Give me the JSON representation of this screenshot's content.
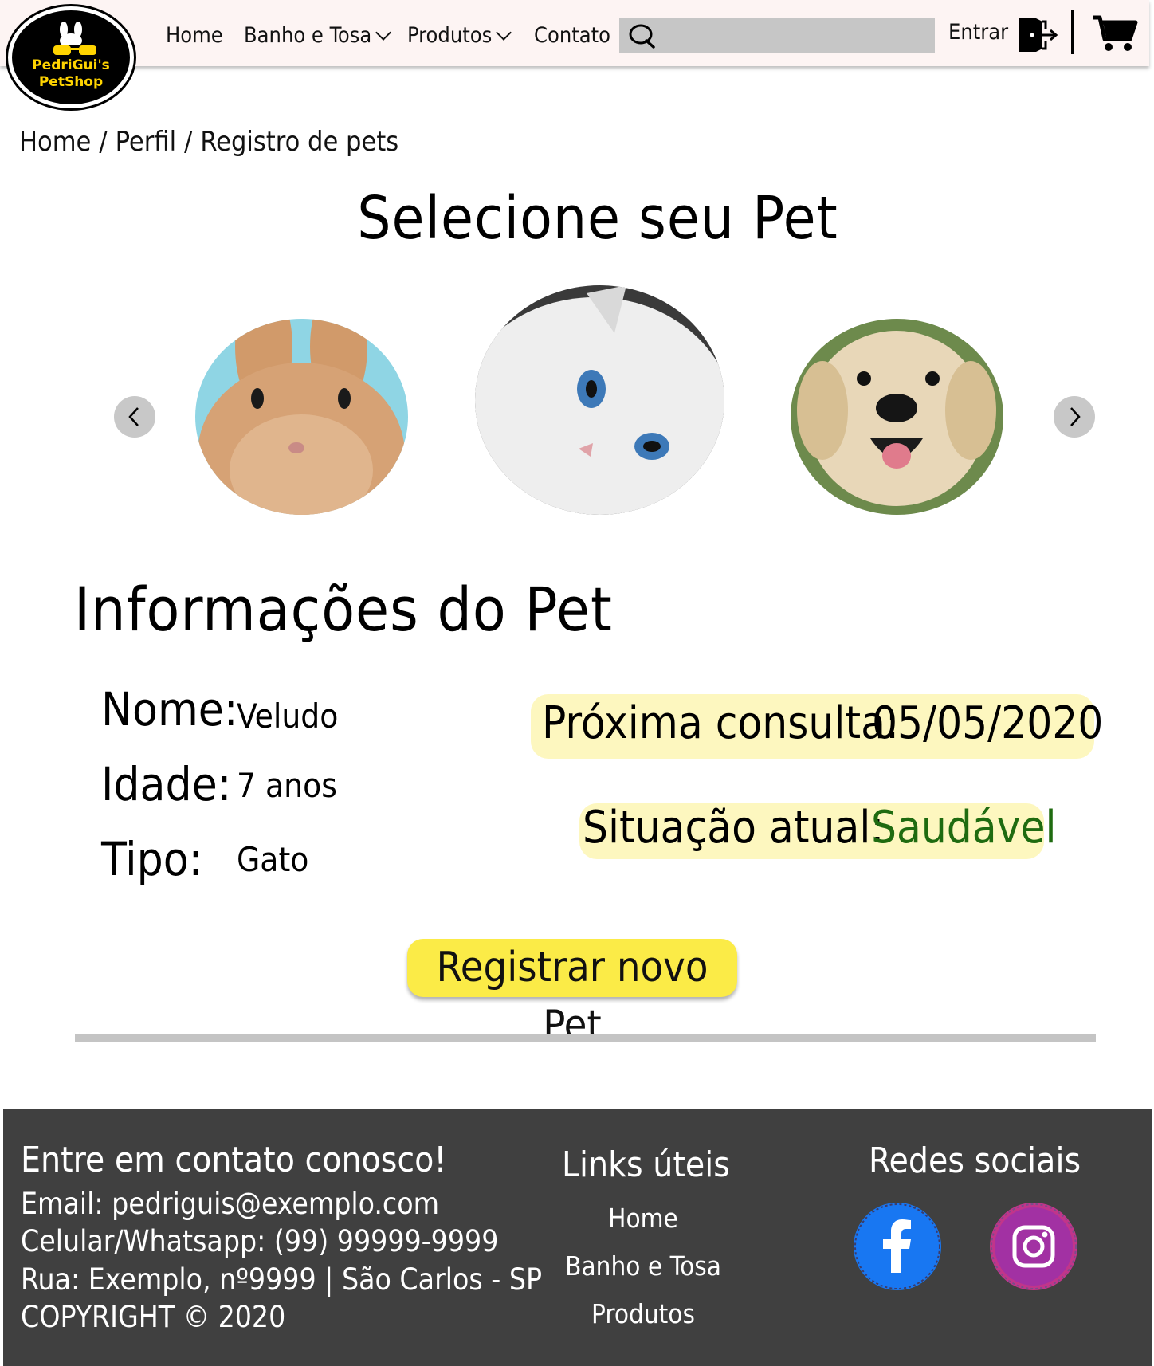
{
  "brand": {
    "logo_line1": "PedriGui's",
    "logo_line2": "PetShop"
  },
  "nav": {
    "home": "Home",
    "banho": "Banho e Tosa",
    "produtos": "Produtos",
    "contato": "Contato",
    "search_placeholder": "",
    "entrar": "Entrar"
  },
  "breadcrumb": {
    "items": [
      "Home",
      "Perfil",
      "Registro de pets"
    ],
    "sep": "/"
  },
  "page": {
    "title": "Selecione seu Pet",
    "info_title": "Informações do Pet"
  },
  "carousel": {
    "pets": [
      "rabbit",
      "cat",
      "dog"
    ],
    "selected": "cat"
  },
  "pet_info": {
    "nome_label": "Nome:",
    "nome": "Veludo",
    "idade_label": "Idade:",
    "idade": "7 anos",
    "tipo_label": "Tipo:",
    "tipo": "Gato",
    "consulta_label": "Próxima consulta:",
    "consulta": "05/05/2020",
    "situacao_label": "Situação atual:",
    "situacao": "Saudável"
  },
  "actions": {
    "register": "Registrar novo Pet"
  },
  "footer": {
    "contact_title": "Entre em contato conosco!",
    "email": "Email: pedriguis@exemplo.com",
    "phone": "Celular/Whatsapp: (99) 99999-9999",
    "address": "Rua: Exemplo, nº9999 | São Carlos - SP",
    "copyright": "COPYRIGHT © 2020",
    "links_title": "Links úteis",
    "links": [
      "Home",
      "Banho e Tosa",
      "Produtos"
    ],
    "social_title": "Redes sociais",
    "social": [
      "facebook",
      "instagram"
    ]
  },
  "colors": {
    "nav_bg": "#fdf4f3",
    "search_bg": "#c6c6c6",
    "pill_bg": "#fdf7bf",
    "button_bg": "#fbeb47",
    "healthy": "#1f6b10",
    "footer_bg": "#404040",
    "logo_yellow": "#ffd400"
  }
}
